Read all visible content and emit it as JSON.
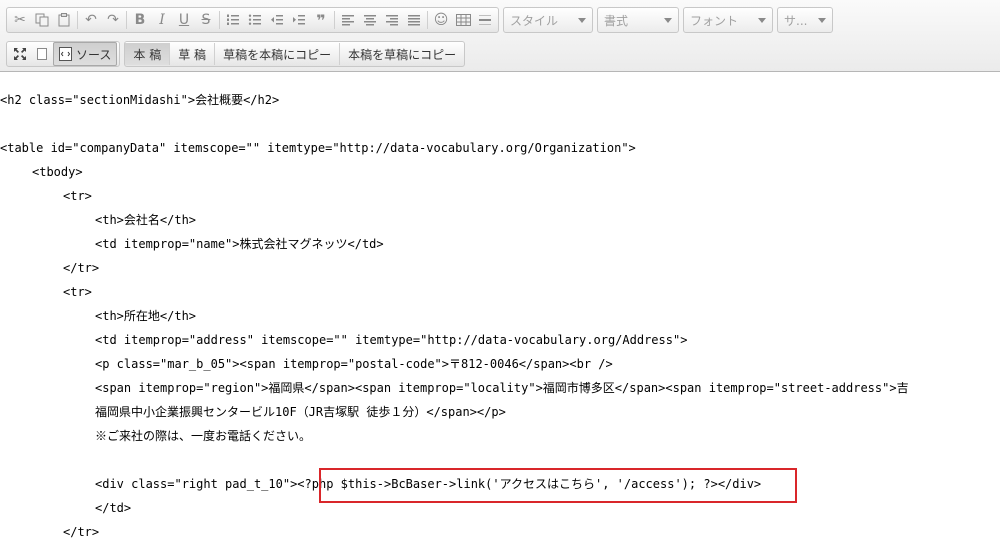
{
  "toolbar": {
    "style_combo": "スタイル",
    "format_combo": "書式",
    "font_combo": "フォント",
    "size_combo": "サ...",
    "source_label": "ソース",
    "honkou_label": "本 稿",
    "soukou_label": "草 稿",
    "copy_draft_to_main": "草稿を本稿にコピー",
    "copy_main_to_draft": "本稿を草稿にコピー"
  },
  "code": {
    "l1": "<h2 class=\"sectionMidashi\">会社概要</h2>",
    "l2": "<table id=\"companyData\" itemscope=\"\" itemtype=\"http://data-vocabulary.org/Organization\">",
    "l3": "<tbody>",
    "l4": "<tr>",
    "l5": "<th>会社名</th>",
    "l6": "<td itemprop=\"name\">株式会社マグネッツ</td>",
    "l7": "</tr>",
    "l8": "<tr>",
    "l9": "<th>所在地</th>",
    "l10": "<td itemprop=\"address\" itemscope=\"\" itemtype=\"http://data-vocabulary.org/Address\">",
    "l11": "<p class=\"mar_b_05\"><span itemprop=\"postal-code\">〒812-0046</span><br />",
    "l12": "<span itemprop=\"region\">福岡県</span><span itemprop=\"locality\">福岡市博多区</span><span itemprop=\"street-address\">吉",
    "l13": "福岡県中小企業振興センタービル10F（JR吉塚駅 徒歩１分）</span></p>",
    "l14": "※ご来社の際は、一度お電話ください。",
    "l15a": "<div class=\"right pad_t_10\">",
    "l15b": "<?php $this->BcBaser->link('アクセスはこちら', '/access'); ?>",
    "l15c": "</div>",
    "l16": "</td>",
    "l17": "</tr>"
  }
}
